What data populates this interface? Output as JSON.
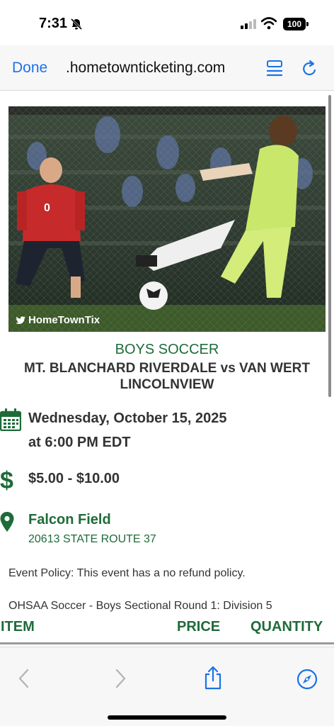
{
  "status_bar": {
    "time": "7:31",
    "battery": "100"
  },
  "browser": {
    "done_label": "Done",
    "url": ".hometownticketing.com"
  },
  "hero": {
    "caption": "HomeTownTix"
  },
  "event": {
    "category": "BOYS SOCCER",
    "title": "MT. BLANCHARD RIVERDALE vs VAN WERT LINCOLNVIEW",
    "date_line1": "Wednesday, October 15, 2025",
    "date_line2": "at 6:00 PM EDT",
    "price": "$5.00 - $10.00",
    "venue": "Falcon Field",
    "address": "20613 STATE ROUTE 37",
    "policy": "Event Policy: This event has a no refund policy.",
    "round": "OHSAA Soccer - Boys Sectional Round 1: Division 5"
  },
  "ticket_table": {
    "headers": [
      "ITEM",
      "PRICE",
      "QUANTITY"
    ]
  },
  "colors": {
    "accent_green": "#1e6b3a",
    "link_blue": "#1a73e8"
  }
}
